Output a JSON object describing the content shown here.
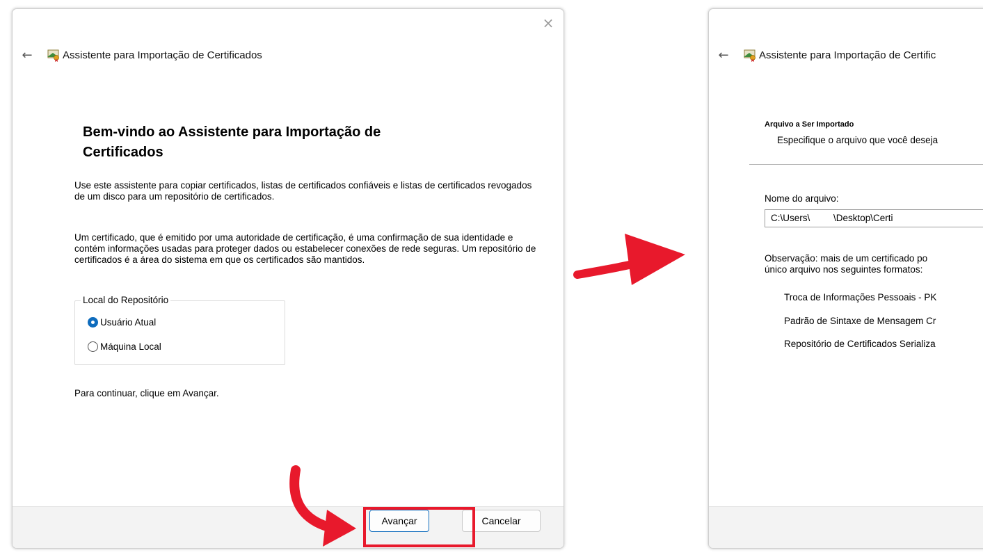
{
  "window1": {
    "close_glyph": "×",
    "back_glyph": "←",
    "wizard_title": "Assistente para Importação de Certificados",
    "heading_line1": "Bem-vindo ao Assistente para Importação de",
    "heading_line2": "Certificados",
    "paragraph1": "Use este assistente para copiar certificados, listas de certificados confiáveis e listas de certificados revogados de um disco para um repositório de certificados.",
    "paragraph2": "Um certificado, que é emitido por uma autoridade de certificação, é uma confirmação de sua identidade e contém informações usadas para proteger dados ou estabelecer conexões de rede seguras. Um repositório de certificados é a área do sistema em que os certificados são mantidos.",
    "store_location": {
      "legend": "Local do Repositório",
      "options": [
        {
          "label": "Usuário Atual",
          "selected": true
        },
        {
          "label": "Máquina Local",
          "selected": false
        }
      ]
    },
    "continue_hint": "Para continuar, clique em Avançar.",
    "buttons": {
      "next": "Avançar",
      "cancel": "Cancelar"
    }
  },
  "window2": {
    "back_glyph": "←",
    "wizard_title": "Assistente para Importação de Certific",
    "step_title": "Arquivo a Ser Importado",
    "step_subtitle": "Especifique o arquivo que você deseja",
    "file_label": "Nome do arquivo:",
    "file_path_part1": "C:\\Users\\",
    "file_path_part2": "\\Desktop\\Certi",
    "note_line1": "Observação: mais de um certificado po",
    "note_line2": "único arquivo nos seguintes formatos:",
    "formats": [
      "Troca de Informações Pessoais - PK",
      "Padrão de Sintaxe de Mensagem Cr",
      "Repositório de Certificados Serializa"
    ]
  },
  "annotations": {
    "arrow_color": "#e8192c",
    "highlight_color": "#e8192c"
  },
  "colors": {
    "accent": "#0f6cbd",
    "footer_bg": "#f3f3f3"
  }
}
